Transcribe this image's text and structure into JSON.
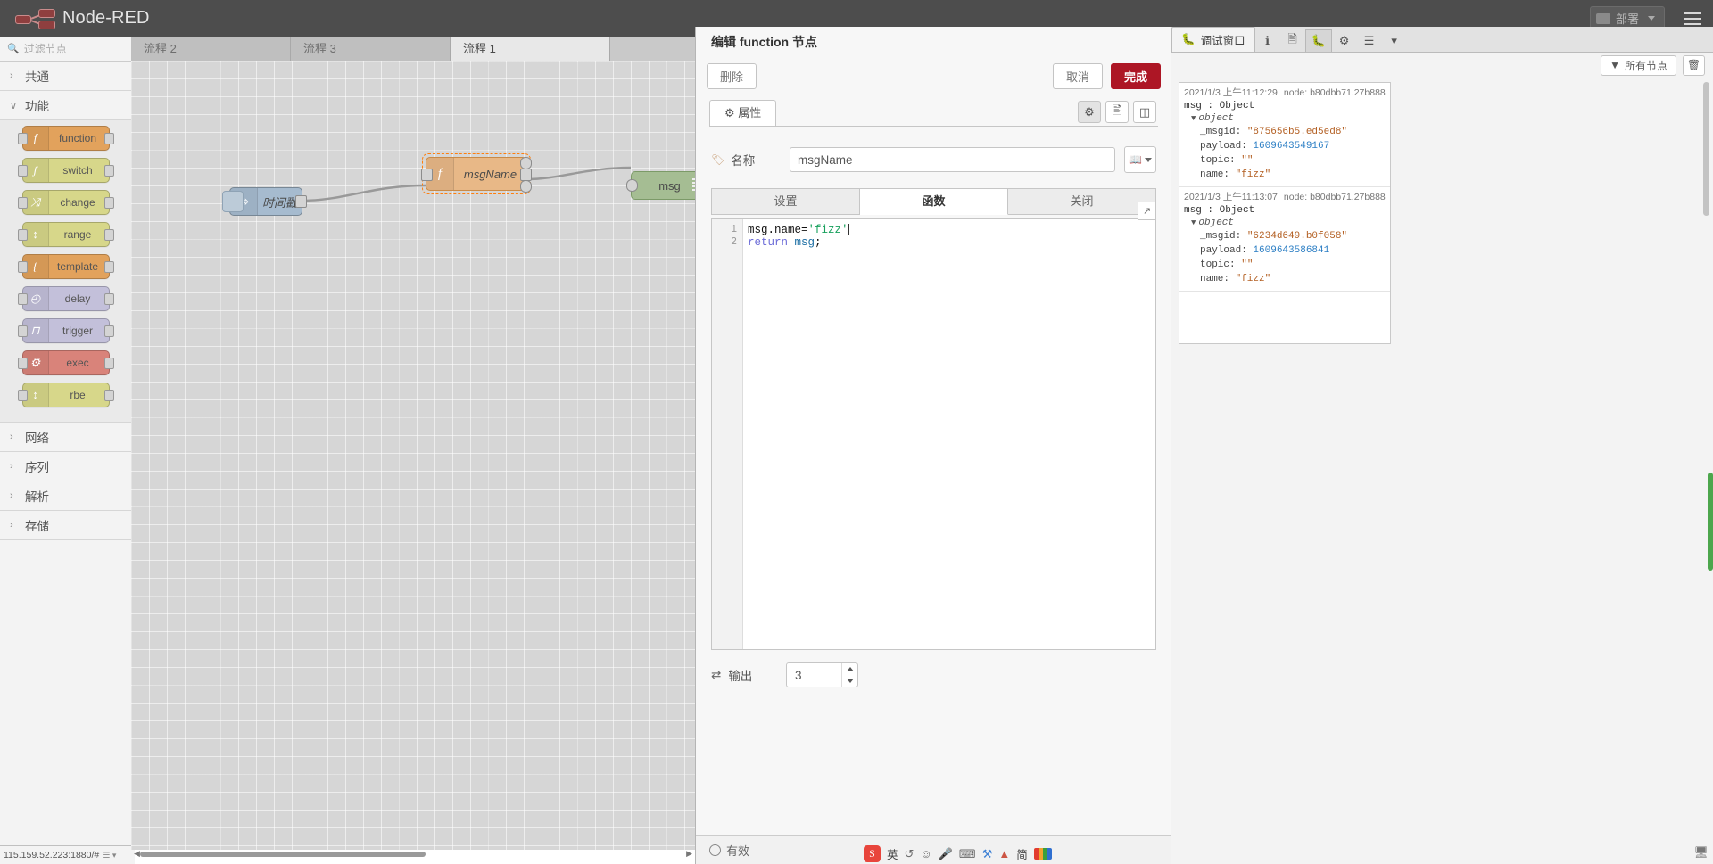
{
  "header": {
    "brand": "Node-RED",
    "deploy_label": "部署",
    "menu_icon": "hamburger-icon",
    "logo_icon": "node-red-logo"
  },
  "palette": {
    "search_placeholder": "过滤节点",
    "search_icon": "search-icon",
    "categories": [
      {
        "label": "共通",
        "expanded": false,
        "nodes": []
      },
      {
        "label": "功能",
        "expanded": true,
        "nodes": [
          {
            "label": "function",
            "icon": "f",
            "color": "#e2a25c",
            "ports": "both"
          },
          {
            "label": "switch",
            "icon": "ʃ",
            "color": "#d7d78a",
            "ports": "both"
          },
          {
            "label": "change",
            "icon": "⤨",
            "color": "#d7d78a",
            "ports": "both"
          },
          {
            "label": "range",
            "icon": "↕",
            "color": "#d7d78a",
            "ports": "both"
          },
          {
            "label": "template",
            "icon": "{",
            "color": "#e2a25c",
            "ports": "both"
          },
          {
            "label": "delay",
            "icon": "◴",
            "color": "#c3c0da",
            "ports": "both"
          },
          {
            "label": "trigger",
            "icon": "⊓",
            "color": "#c3c0da",
            "ports": "both"
          },
          {
            "label": "exec",
            "icon": "⚙",
            "color": "#d9837a",
            "ports": "both"
          },
          {
            "label": "rbe",
            "icon": "↕",
            "color": "#d7d78a",
            "ports": "both"
          }
        ]
      },
      {
        "label": "网络",
        "expanded": false,
        "nodes": []
      },
      {
        "label": "序列",
        "expanded": false,
        "nodes": []
      },
      {
        "label": "解析",
        "expanded": false,
        "nodes": []
      },
      {
        "label": "存储",
        "expanded": false,
        "nodes": []
      }
    ]
  },
  "flow": {
    "tabs": [
      {
        "label": "流程 2",
        "active": false
      },
      {
        "label": "流程 3",
        "active": false
      },
      {
        "label": "流程 1",
        "active": true
      }
    ],
    "nodes": [
      {
        "label": "时间戳",
        "type": "inject",
        "color": "#a6bbcf",
        "icon": "⇨",
        "selected": false
      },
      {
        "label": "msgName",
        "type": "function",
        "color": "#e8b887",
        "icon": "f",
        "selected": true
      },
      {
        "label": "msg",
        "type": "debug",
        "color": "#a6bbcf",
        "icon": "↘",
        "selected": false
      }
    ]
  },
  "statusbar": {
    "address": "115.159.52.223:1880/#"
  },
  "editor": {
    "title": "编辑 function 节点",
    "delete_label": "删除",
    "cancel_label": "取消",
    "done_label": "完成",
    "tab_properties": "属性",
    "tab_properties_icon": "gear-icon",
    "tool_icons": [
      "gear-icon",
      "document-icon",
      "expand-icon"
    ],
    "name_label": "名称",
    "name_icon": "tag-icon",
    "name_value": "msgName",
    "name_placeholder": "Name",
    "book_icon": "book-icon",
    "subtabs": [
      {
        "label": "设置",
        "active": false
      },
      {
        "label": "函数",
        "active": true
      },
      {
        "label": "关闭",
        "active": false
      }
    ],
    "expand_icon": "expand-arrows-icon",
    "code": {
      "lines": [
        {
          "num": "1",
          "tokens": [
            {
              "t": "msg.name=",
              "c": "tok-prop"
            },
            {
              "t": "'fizz'",
              "c": "tok-str"
            }
          ],
          "caret": true
        },
        {
          "num": "2",
          "tokens": [
            {
              "t": "return ",
              "c": "tok-kw"
            },
            {
              "t": "msg",
              "c": "tok-var"
            },
            {
              "t": ";",
              "c": "tok-prop"
            }
          ],
          "caret": false
        }
      ]
    },
    "outputs_label": "输出",
    "outputs_icon": "outputs-icon",
    "outputs_value": "3",
    "enabled_label": "有效"
  },
  "ime": {
    "logo": "S",
    "mode_label": "英",
    "icons": [
      "smiley-icon",
      "mic-icon",
      "keyboard-icon",
      "tools-icon",
      "up-icon",
      "simplified-icon",
      "rainbow-icon"
    ],
    "simplified_label": "简"
  },
  "debug": {
    "panel_title": "调试窗口",
    "panel_icon": "bug-icon",
    "tab_icons": [
      "info-icon",
      "help-icon",
      "bug-icon",
      "config-icon",
      "context-icon",
      "caret-down-icon"
    ],
    "filter_label": "所有节点",
    "filter_icon": "filter-icon",
    "trash_icon": "trash-icon",
    "messages": [
      {
        "timestamp": "2021/1/3 上午11:12:29",
        "node": "node: b80dbb71.27b888",
        "head": "msg : Object",
        "obj": "object",
        "props": [
          {
            "key": "_msgid: ",
            "value": "\"875656b5.ed5ed8\"",
            "type": "str"
          },
          {
            "key": "payload: ",
            "value": "1609643549167",
            "type": "num"
          },
          {
            "key": "topic: ",
            "value": "\"\"",
            "type": "str"
          },
          {
            "key": "name: ",
            "value": "\"fizz\"",
            "type": "str"
          }
        ]
      },
      {
        "timestamp": "2021/1/3 上午11:13:07",
        "node": "node: b80dbb71.27b888",
        "head": "msg : Object",
        "obj": "object",
        "props": [
          {
            "key": "_msgid: ",
            "value": "\"6234d649.b0f058\"",
            "type": "str"
          },
          {
            "key": "payload: ",
            "value": "1609643586841",
            "type": "num"
          },
          {
            "key": "topic: ",
            "value": "\"\"",
            "type": "str"
          },
          {
            "key": "name: ",
            "value": "\"fizz\"",
            "type": "str"
          }
        ]
      }
    ],
    "bottom_icon": "monitor-icon"
  },
  "colors": {
    "accent_red": "#ad1625",
    "header_bg": "#4d4d4d",
    "canvas_bg": "#d6d6d6",
    "scroll_green": "#4ca64c"
  }
}
